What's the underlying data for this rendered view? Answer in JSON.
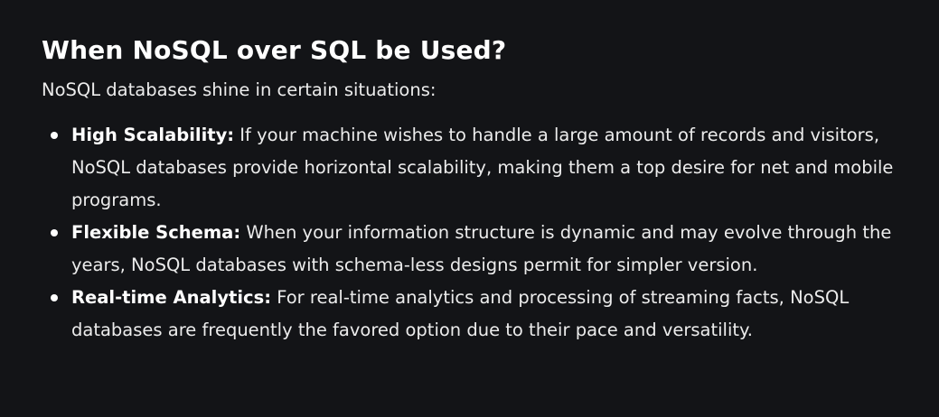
{
  "article": {
    "heading": "When NoSQL over SQL be Used?",
    "intro": "NoSQL databases shine in certain situations:",
    "items": [
      {
        "term": "High Scalability:",
        "text": " If your machine wishes to handle a large amount of records and visitors, NoSQL databases provide horizontal scalability, making them a top desire for net and mobile programs."
      },
      {
        "term": "Flexible Schema:",
        "text": " When your information structure is dynamic and may evolve through the years, NoSQL databases with schema-less designs permit for simpler version."
      },
      {
        "term": "Real-time Analytics:",
        "text": " For real-time analytics and processing of streaming facts, NoSQL databases are frequently the favored option due to their pace and versatility."
      }
    ]
  }
}
